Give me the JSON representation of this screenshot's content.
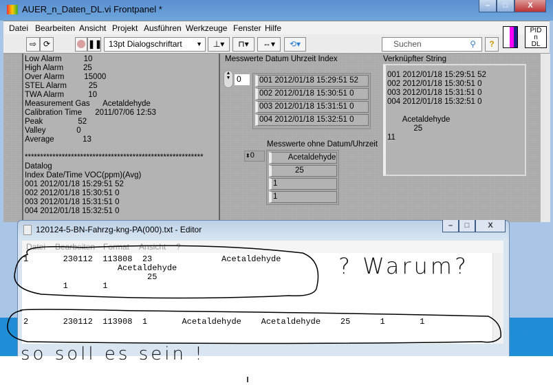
{
  "lv_window": {
    "title": "AUER_n_Daten_DL.vi Frontpanel *",
    "controls": {
      "minimize": "–",
      "maximize": "□",
      "close": "X"
    }
  },
  "menu": [
    "Datei",
    "Bearbeiten",
    "Ansicht",
    "Projekt",
    "Ausführen",
    "Werkzeuge",
    "Fenster",
    "Hilfe"
  ],
  "toolbar": {
    "font": "13pt Dialogschriftart",
    "search_placeholder": "Suchen",
    "help": "?",
    "vi_icon": "PID n DL"
  },
  "left_string": "Low Alarm          10\nHigh Alarm         25\nOver Alarm         15000\nSTEL Alarm          25\nTWA Alarm           10\nMeasurement Gas      Acetaldehyde\nCalibration Time      2011/07/06 12:53\nPeak                52\nValley              0\nAverage             13\n\n**********************************************************\nDatalog\nIndex Date/Time VOC(ppm)(Avg)\n001 2012/01/18 15:29:51 52\n002 2012/01/18 15:30:51 0\n003 2012/01/18 15:31:51 0\n004 2012/01/18 15:32:51 0",
  "array1": {
    "label": "Messwerte Datum Uhrzeit Index",
    "index": "0",
    "items": [
      "001 2012/01/18 15:29:51 52",
      "002 2012/01/18 15:30:51 0",
      "003 2012/01/18 15:31:51 0",
      "004 2012/01/18 15:32:51 0"
    ]
  },
  "array2": {
    "label": "Messwerte ohne Datum/Uhrzeit",
    "index": "0",
    "items": [
      "       Acetaldehyde",
      "          25",
      "1",
      "1"
    ]
  },
  "concat": {
    "label": "Verknüpfter String",
    "value": "001 2012/01/18 15:29:51 52\n002 2012/01/18 15:30:51 0\n003 2012/01/18 15:31:51 0\n004 2012/01/18 15:32:51 0\n\n       Acetaldehyde\n            25\n11"
  },
  "notepad": {
    "title": "120124-5-BN-Fahrzg-kng-PA(000).txt - Editor",
    "menu": [
      "Datei",
      "Bearbeiten",
      "Format",
      "Ansicht",
      "?"
    ],
    "text": "1       230112  113808  23              Acetaldehyde\n                   Acetaldehyde\n                         25\n        1       1\n\n\n\n2       230112  113908  1       Acetaldehyde    Acetaldehyde    25      1       1"
  },
  "annotations": {
    "question": "? Warum?",
    "answer": "so soll es sein !"
  }
}
